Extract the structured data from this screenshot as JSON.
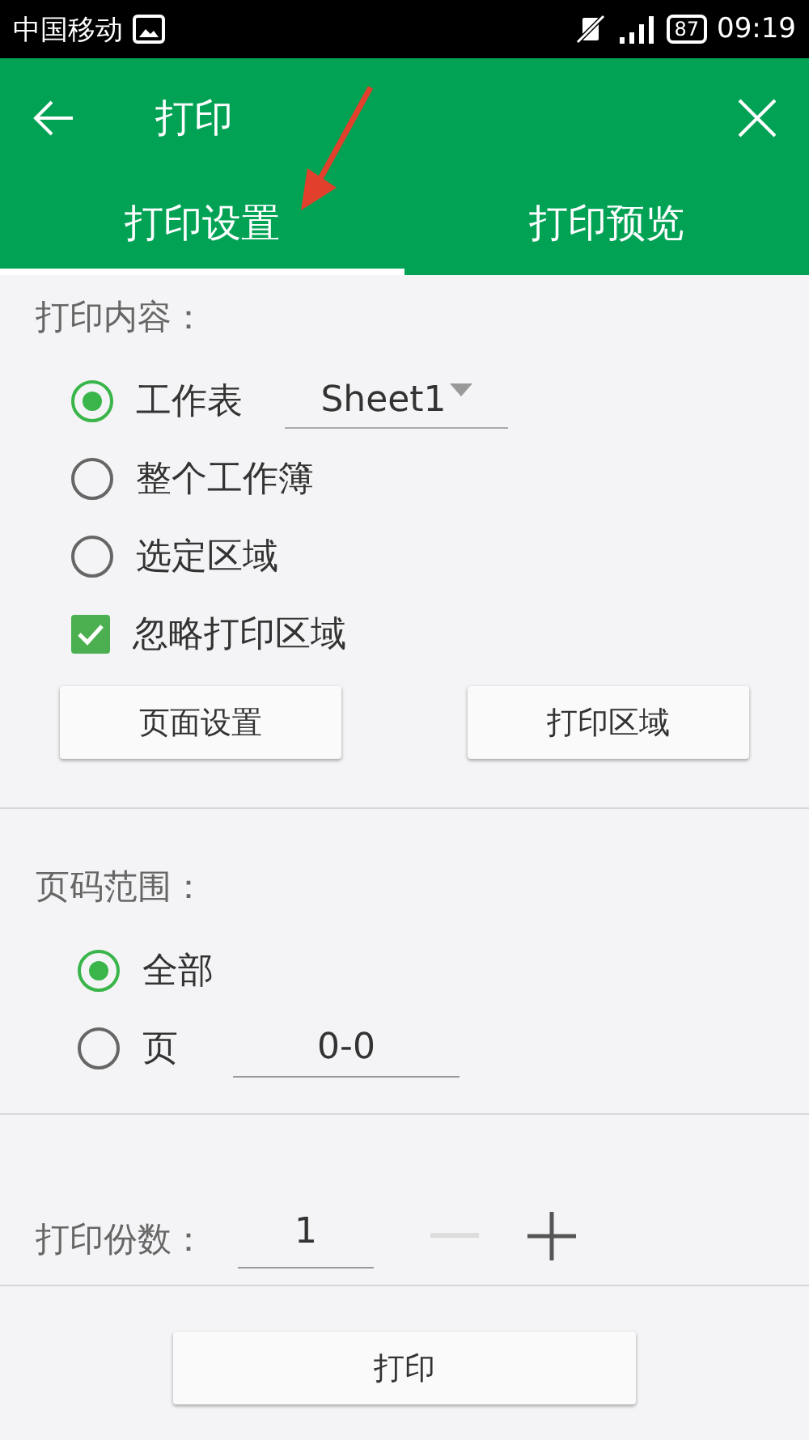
{
  "status_bar": {
    "carrier": "中国移动",
    "battery": "87",
    "time": "09:19"
  },
  "app_bar": {
    "title": "打印"
  },
  "tabs": [
    {
      "label": "打印设置",
      "selected": true
    },
    {
      "label": "打印预览",
      "selected": false
    }
  ],
  "content_section": {
    "heading": "打印内容：",
    "options": [
      {
        "kind": "radio",
        "label": "工作表",
        "selected": true,
        "dropdown_value": "Sheet1"
      },
      {
        "kind": "radio",
        "label": "整个工作簿",
        "selected": false
      },
      {
        "kind": "radio",
        "label": "选定区域",
        "selected": false
      },
      {
        "kind": "checkbox",
        "label": "忽略打印区域",
        "checked": true
      }
    ],
    "buttons": [
      "页面设置",
      "打印区域"
    ]
  },
  "page_range": {
    "heading": "页码范围：",
    "options": [
      {
        "label": "全部",
        "selected": true
      },
      {
        "label": "页",
        "selected": false,
        "value": "0-0"
      }
    ]
  },
  "copies": {
    "label": "打印份数：",
    "value": "1",
    "decrement_disabled": true
  },
  "print_button": "打印"
}
